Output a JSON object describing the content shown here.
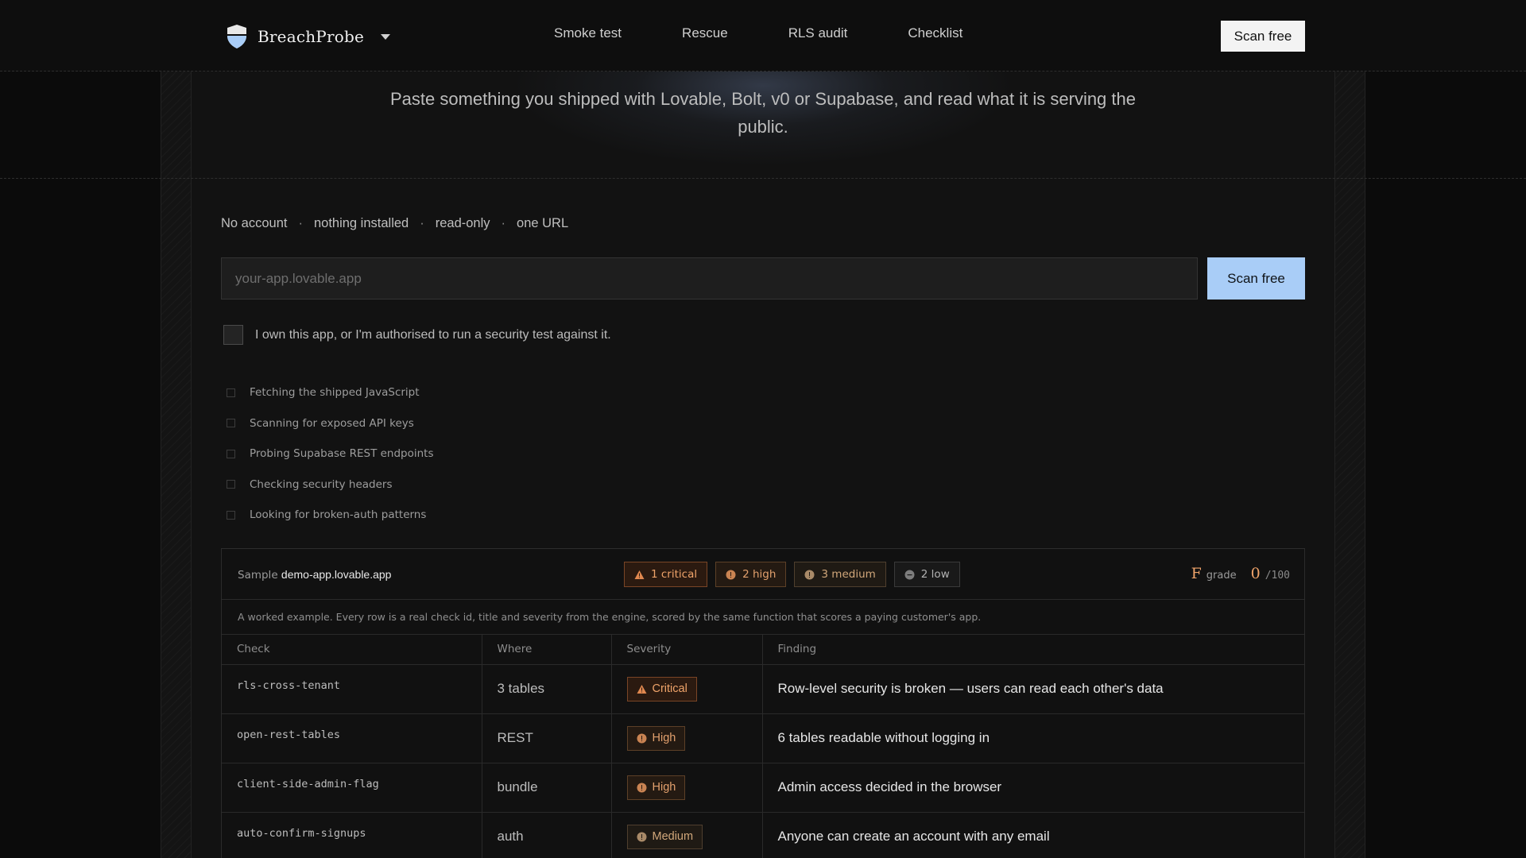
{
  "brand": {
    "name": "BreachProbe"
  },
  "nav": [
    "Smoke test",
    "Rescue",
    "RLS audit",
    "Checklist"
  ],
  "header_cta": "Scan free",
  "hero": {
    "subtitle": "Paste something you shipped with Lovable, Bolt, v0 or Supabase, and read what it is serving the public."
  },
  "perks": [
    "No account",
    "nothing installed",
    "read-only",
    "one URL"
  ],
  "scan": {
    "placeholder": "your-app.lovable.app",
    "button": "Scan free",
    "consent": "I own this app, or I'm authorised to run a security test against it."
  },
  "steps": [
    "Fetching the shipped JavaScript",
    "Scanning for exposed API keys",
    "Probing Supabase REST endpoints",
    "Checking security headers",
    "Looking for broken-auth patterns"
  ],
  "sample": {
    "prefix": "Sample",
    "host": "demo-app.lovable.app",
    "pills": {
      "critical": "1 critical",
      "high": "2 high",
      "medium": "3 medium",
      "low": "2 low"
    },
    "grade_letter": "F",
    "grade_label": "grade",
    "score": "0",
    "score_of": "/100",
    "note": "A worked example. Every row is a real check id, title and severity from the engine, scored by the same function that scores a paying customer's app.",
    "columns": [
      "Check",
      "Where",
      "Severity",
      "Finding"
    ],
    "rows": [
      {
        "check": "rls-cross-tenant",
        "where": "3 tables",
        "severity": "Critical",
        "finding": "Row-level security is broken — users can read each other's data"
      },
      {
        "check": "open-rest-tables",
        "where": "REST",
        "severity": "High",
        "finding": "6 tables readable without logging in"
      },
      {
        "check": "client-side-admin-flag",
        "where": "bundle",
        "severity": "High",
        "finding": "Admin access decided in the browser"
      },
      {
        "check": "auto-confirm-signups",
        "where": "auth",
        "severity": "Medium",
        "finding": "Anyone can create an account with any email"
      }
    ]
  },
  "colors": {
    "accent_button": "#a9cdf7",
    "critical": "#f0a46a",
    "background": "#0b0b0b"
  }
}
